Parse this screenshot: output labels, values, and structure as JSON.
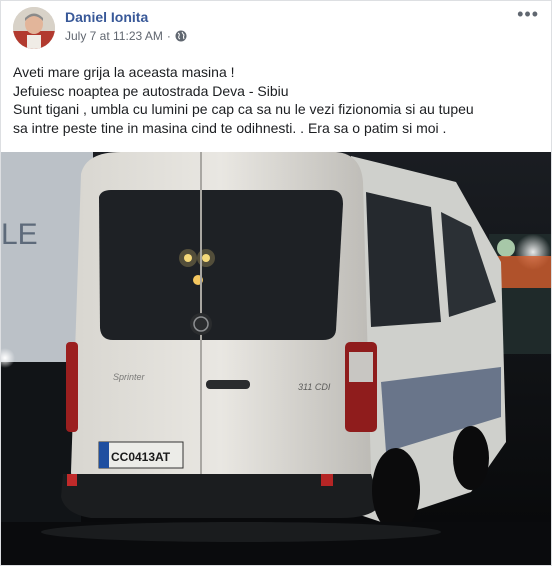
{
  "post": {
    "author": "Daniel Ionita",
    "timestamp": "July 7 at 11:23 AM",
    "separator": "·",
    "privacy_icon": "globe-icon",
    "more_label": "•••",
    "lines": [
      "Aveti mare grija la aceasta masina !",
      "Jefuiesc noaptea pe autostrada Deva - Sibiu",
      "Sunt tigani , umbla cu lumini pe cap ca sa nu le vezi fizionomia si au tupeu",
      "sa intre peste tine in masina cind te odihnesti. . Era sa o patim si moi ."
    ]
  },
  "photo": {
    "trailer_text": "LE",
    "van_model": "Sprinter",
    "van_badge": "311 CDI",
    "plate": "CC0413AT"
  },
  "colors": {
    "author_link": "#385898",
    "meta_gray": "#616770",
    "body_text": "#1c1e21"
  }
}
